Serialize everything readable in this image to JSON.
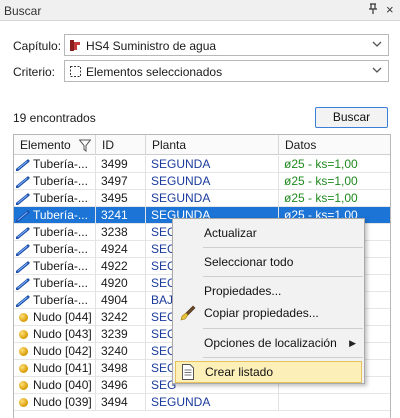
{
  "window": {
    "title": "Buscar",
    "pin_glyph": "⊓",
    "close_glyph": "×"
  },
  "capitulo": {
    "label": "Capítulo:",
    "value": "HS4 Suministro de agua",
    "icon": "chapter-icon"
  },
  "criterio": {
    "label": "Criterio:",
    "value": "Elementos seleccionados",
    "icon": "selection-rect-icon"
  },
  "results": {
    "count_text": "19 encontrados",
    "search_button": "Buscar"
  },
  "table": {
    "headers": [
      "Elemento",
      "ID",
      "Planta",
      "Datos"
    ],
    "rows": [
      {
        "type": "pipe",
        "elemento": "Tubería-...",
        "id": "3499",
        "planta": "SEGUNDA",
        "datos": "ø25 - ks=1,00",
        "selected": false
      },
      {
        "type": "pipe",
        "elemento": "Tubería-...",
        "id": "3497",
        "planta": "SEGUNDA",
        "datos": "ø25 - ks=1,00",
        "selected": false
      },
      {
        "type": "pipe",
        "elemento": "Tubería-...",
        "id": "3495",
        "planta": "SEGUNDA",
        "datos": "ø25 - ks=1,00",
        "selected": false
      },
      {
        "type": "pipe",
        "elemento": "Tubería-...",
        "id": "3241",
        "planta": "SEGUNDA",
        "datos": "ø25 - ks=1,00",
        "selected": true
      },
      {
        "type": "pipe",
        "elemento": "Tubería-...",
        "id": "3238",
        "planta": "SEG",
        "datos": "",
        "selected": false
      },
      {
        "type": "pipe",
        "elemento": "Tubería-...",
        "id": "4924",
        "planta": "SEG",
        "datos": "",
        "selected": false
      },
      {
        "type": "pipe",
        "elemento": "Tubería-...",
        "id": "4922",
        "planta": "SEG",
        "datos": "",
        "selected": false
      },
      {
        "type": "pipe",
        "elemento": "Tubería-...",
        "id": "4920",
        "planta": "SEG",
        "datos": "",
        "selected": false
      },
      {
        "type": "pipe",
        "elemento": "Tubería-...",
        "id": "4904",
        "planta": "BAJ",
        "datos": "",
        "selected": false
      },
      {
        "type": "node",
        "elemento": "Nudo [044]",
        "id": "3242",
        "planta": "SEG",
        "datos": "",
        "selected": false
      },
      {
        "type": "node",
        "elemento": "Nudo [043]",
        "id": "3239",
        "planta": "SEG",
        "datos": "",
        "selected": false
      },
      {
        "type": "node",
        "elemento": "Nudo [042]",
        "id": "3240",
        "planta": "SEG",
        "datos": "",
        "selected": false
      },
      {
        "type": "node",
        "elemento": "Nudo [041]",
        "id": "3498",
        "planta": "SEG",
        "datos": "",
        "selected": false
      },
      {
        "type": "node",
        "elemento": "Nudo [040]",
        "id": "3496",
        "planta": "SEG",
        "datos": "",
        "selected": false
      },
      {
        "type": "node",
        "elemento": "Nudo [039]",
        "id": "3494",
        "planta": "SEGUNDA",
        "datos": "",
        "selected": false
      }
    ]
  },
  "context_menu": {
    "items": [
      {
        "label": "Actualizar",
        "icon": "",
        "submenu": false,
        "highlighted": false
      },
      {
        "label": "Seleccionar todo",
        "icon": "",
        "submenu": false,
        "highlighted": false
      },
      {
        "label": "Propiedades...",
        "icon": "",
        "submenu": false,
        "highlighted": false
      },
      {
        "label": "Copiar propiedades...",
        "icon": "brush-icon",
        "submenu": false,
        "highlighted": false
      },
      {
        "label": "Opciones de localización",
        "icon": "",
        "submenu": true,
        "highlighted": false
      },
      {
        "label": "Crear listado",
        "icon": "document-icon",
        "submenu": false,
        "highlighted": true
      }
    ]
  },
  "colors": {
    "selection": "#1b74d6",
    "planta_text": "#1a3b9c",
    "datos_text": "#1f8a1f",
    "menu_highlight": "#fcefb8",
    "button_border": "#3b7fd6"
  }
}
